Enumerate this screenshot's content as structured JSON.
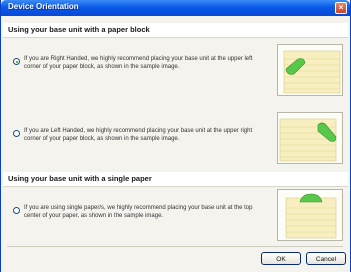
{
  "window": {
    "title": "Device Orientation",
    "close_glyph": "×"
  },
  "sections": [
    {
      "header": "Using your base unit with a paper block"
    },
    {
      "header": "Using your base unit with a single paper"
    }
  ],
  "options": [
    {
      "text": "If you are Right Handed, we highly recommend placing your base unit at the upper left corner of your paper block, as shown in the sample image.",
      "selected": true
    },
    {
      "text": "If you are Left Handed, we highly recommend placing your base unit at the upper right corner of your paper block, as shown in the sample image.",
      "selected": false
    },
    {
      "text": "If you are using single paper/s, we highly recommend placing your base unit at the top center of your paper, as shown in the sample image.",
      "selected": false
    }
  ],
  "buttons": {
    "ok": "OK",
    "cancel": "Cancel"
  },
  "colors": {
    "device": "#58c84a",
    "paper": "#f7efc0",
    "paper_line": "#e2d48a"
  },
  "icons": [
    "close-icon",
    "radio-icon",
    "sample-image-right-handed",
    "sample-image-left-handed",
    "sample-image-single-paper"
  ]
}
